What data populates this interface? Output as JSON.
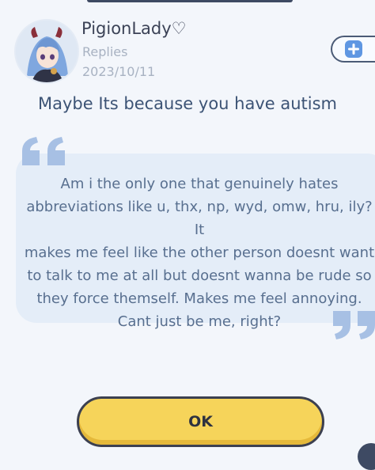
{
  "profile": {
    "username": "PigionLady♡",
    "subtitle": "Replies",
    "date": "2023/10/11",
    "avatar_icon": "character-avatar"
  },
  "header": {
    "add_icon": "plus-icon"
  },
  "reply_text": "Maybe Its because you have autism",
  "quote": {
    "lines": [
      "Am i the only one that genuinely hates",
      "abbreviations like u, thx, np, wyd, omw, hru, ily? It",
      "makes me feel like the other person doesnt want",
      "to talk to me at all but doesnt wanna be rude so",
      "they force themself. Makes me feel annoying.",
      "Cant just be me, right?"
    ]
  },
  "ok_button": {
    "label": "OK"
  },
  "colors": {
    "background": "#f3f6fb",
    "bubble": "#e4edf8",
    "quote_mark": "#a7c0e4",
    "button": "#f6d45a",
    "accent_blue": "#5f97e2"
  }
}
